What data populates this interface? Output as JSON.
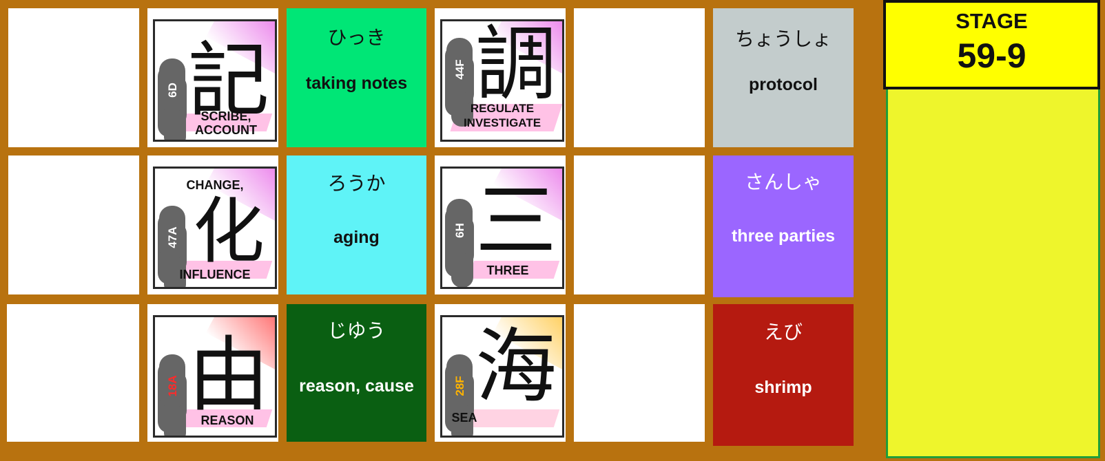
{
  "stage": {
    "label": "STAGE",
    "number": "59-9"
  },
  "rows": [
    {
      "card1": {
        "code": "6D",
        "kanji": "記",
        "meaning": [
          "SCRIBE,",
          "ACCOUNT"
        ],
        "accent": "#e040e0"
      },
      "vocab": {
        "kana": "ひっき",
        "gloss": "taking notes",
        "bg": "#00e676",
        "fg": "#111111"
      },
      "card2": {
        "code": "44F",
        "kanji": "調",
        "meaning": [
          "REGULATE",
          "INVESTIGATE"
        ],
        "accent": "#e040e0"
      },
      "answer": {
        "kana": "ちょうしょ",
        "gloss": "protocol",
        "bg": "#c3cccc",
        "fg": "#111111"
      }
    },
    {
      "card1": {
        "code": "47A",
        "kanji": "化",
        "meaning_top": "CHANGE,",
        "meaning": [
          "INFLUENCE"
        ],
        "accent": "#e040e0"
      },
      "vocab": {
        "kana": "ろうか",
        "gloss": "aging",
        "bg": "#5ff3f7",
        "fg": "#111111"
      },
      "card2": {
        "code": "6H",
        "kanji": "三",
        "meaning": [
          "THREE"
        ],
        "accent": "#e040e0"
      },
      "answer": {
        "kana": "さんしゃ",
        "gloss": "three parties",
        "bg": "#9b66ff",
        "fg": "#ffffff"
      }
    },
    {
      "card1": {
        "code": "18A",
        "kanji": "由",
        "meaning": [
          "REASON"
        ],
        "accent": "#ff2020",
        "code_color": "#ff2a2a"
      },
      "vocab": {
        "kana": "じゆう",
        "gloss": "reason, cause",
        "bg": "#0a5f12",
        "fg": "#ffffff"
      },
      "card2": {
        "code": "28F",
        "kanji": "海",
        "meaning": [
          "SEA"
        ],
        "accent": "#ffb300",
        "code_color": "#ffb300"
      },
      "answer": {
        "kana": "えび",
        "gloss": "shrimp",
        "bg": "#b51a10",
        "fg": "#ffffff"
      }
    }
  ]
}
